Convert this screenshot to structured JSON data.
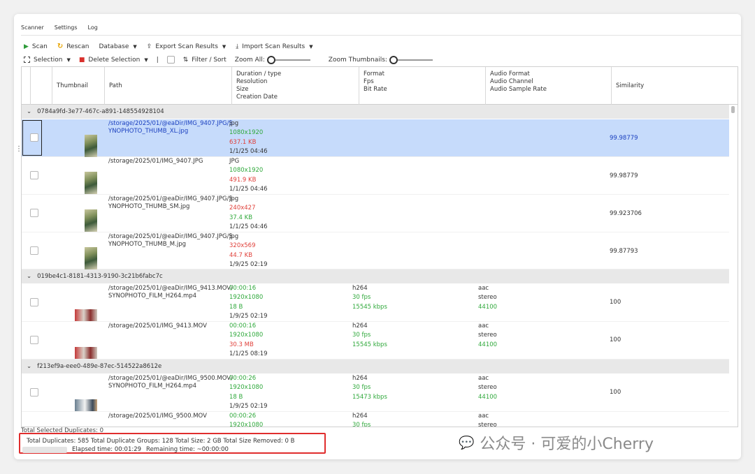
{
  "tabs": [
    "Scanner",
    "Settings",
    "Log"
  ],
  "toolbar": {
    "scan": "Scan",
    "rescan": "Rescan",
    "database": "Database",
    "export": "Export Scan Results",
    "import": "Import Scan Results",
    "selection": "Selection",
    "delete_selection": "Delete Selection",
    "separator": "|",
    "filter_sort": "Filter / Sort",
    "zoom_all": "Zoom All:",
    "zoom_thumbnails": "Zoom Thumbnails:"
  },
  "columns": {
    "thumbnail": "Thumbnail",
    "path": "Path",
    "duration_l1": "Duration / type",
    "duration_l2": "Resolution",
    "duration_l3": "Size",
    "duration_l4": "Creation Date",
    "format_l1": "Format",
    "format_l2": "Fps",
    "format_l3": "Bit Rate",
    "audio_l1": "Audio Format",
    "audio_l2": "Audio Channel",
    "audio_l3": "Audio Sample Rate",
    "similarity": "Similarity"
  },
  "groups": [
    {
      "id": "0784a9fd-3e77-467c-a891-148554928104",
      "rows": [
        {
          "path": "/storage/2025/01/@eaDir/IMG_9407.JPG/SYNOPHOTO_THUMB_XL.jpg",
          "type": "jpg",
          "resolution": "1080x1920",
          "size": "637.1 KB",
          "date": "1/1/25 04:46",
          "similarity": "99.98779"
        },
        {
          "path": "/storage/2025/01/IMG_9407.JPG",
          "type": "JPG",
          "resolution": "1080x1920",
          "size": "491.9 KB",
          "date": "1/1/25 04:46",
          "similarity": "99.98779"
        },
        {
          "path": "/storage/2025/01/@eaDir/IMG_9407.JPG/SYNOPHOTO_THUMB_SM.jpg",
          "type": "jpg",
          "resolution": "240x427",
          "size": "37.4 KB",
          "date": "1/1/25 04:46",
          "similarity": "99.923706"
        },
        {
          "path": "/storage/2025/01/@eaDir/IMG_9407.JPG/SYNOPHOTO_THUMB_M.jpg",
          "type": "jpg",
          "resolution": "320x569",
          "size": "44.7 KB",
          "date": "1/9/25 02:19",
          "similarity": "99.87793"
        }
      ]
    },
    {
      "id": "019be4c1-8181-4313-9190-3c21b6fabc7c",
      "rows": [
        {
          "path": "/storage/2025/01/@eaDir/IMG_9413.MOV/SYNOPHOTO_FILM_H264.mp4",
          "type": "00:00:16",
          "resolution": "1920x1080",
          "size": "18 B",
          "date": "1/9/25 02:19",
          "format": "h264",
          "fps": "30 fps",
          "bitrate": "15545 kbps",
          "audio_format": "aac",
          "audio_channel": "stereo",
          "audio_rate": "44100",
          "similarity": "100"
        },
        {
          "path": "/storage/2025/01/IMG_9413.MOV",
          "type": "00:00:16",
          "resolution": "1920x1080",
          "size": "30.3 MB",
          "date": "1/1/25 08:19",
          "format": "h264",
          "fps": "30 fps",
          "bitrate": "15545 kbps",
          "audio_format": "aac",
          "audio_channel": "stereo",
          "audio_rate": "44100",
          "similarity": "100"
        }
      ]
    },
    {
      "id": "f213ef9a-eee0-489e-87ec-514522a8612e",
      "rows": [
        {
          "path": "/storage/2025/01/@eaDir/IMG_9500.MOV/SYNOPHOTO_FILM_H264.mp4",
          "type": "00:00:26",
          "resolution": "1920x1080",
          "size": "18 B",
          "date": "1/9/25 02:19",
          "format": "h264",
          "fps": "30 fps",
          "bitrate": "15473 kbps",
          "audio_format": "aac",
          "audio_channel": "stereo",
          "audio_rate": "44100",
          "similarity": "100"
        },
        {
          "path": "/storage/2025/01/IMG_9500.MOV",
          "type": "00:00:26",
          "resolution": "1920x1080",
          "format": "h264",
          "fps": "30 fps",
          "audio_format": "aac",
          "audio_channel": "stereo"
        }
      ]
    }
  ],
  "status": {
    "selected": "Total Selected Duplicates: 0",
    "totals": "Total Duplicates: 585   Total Duplicate Groups: 128   Total Size: 2 GB   Total Size Removed: 0 B",
    "elapsed": "Elapsed time: 00:01:29",
    "remaining": "Remaining time: ~00:00:00"
  },
  "watermark": {
    "text": "公众号 · 可爱的小Cherry"
  },
  "colors": {
    "selected_row": "#c6dbfb",
    "green_value": "#2ea83a",
    "red_value": "#e0403a",
    "status_border": "#e02d2d"
  }
}
